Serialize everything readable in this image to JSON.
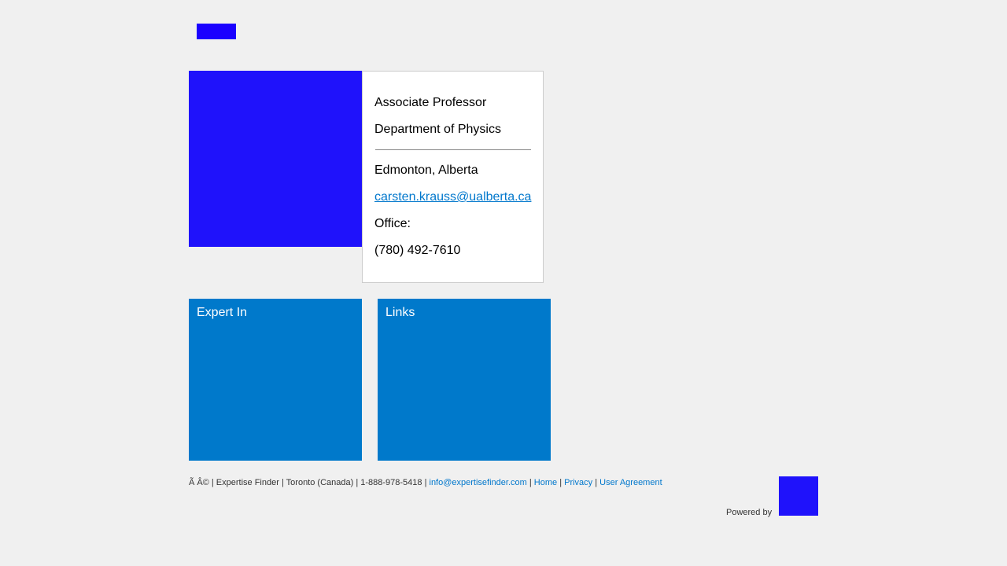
{
  "header": {
    "logo_color": "#1a00ff"
  },
  "profile": {
    "photo_color": "#1f12fb",
    "title": "Associate Professor",
    "department": "Department of Physics",
    "location": "Edmonton, Alberta",
    "email": "carsten.krauss@ualberta.ca",
    "office_label": "Office:",
    "phone": "(780) 492-7610"
  },
  "tiles": [
    {
      "label": "Expert In",
      "color": "#0079cb"
    },
    {
      "label": "Links",
      "color": "#0079cb"
    }
  ],
  "footer": {
    "copyright": "Ã   Â© | Expertise Finder | Toronto (Canada) | 1-888-978-5418 |",
    "email_link": "info@expertisefinder.com",
    "sep": "|",
    "home_link": "Home",
    "privacy_link": "Privacy",
    "agreement_link": "User Agreement",
    "powered_by": "Powered by",
    "powered_logo_color": "#1f12fb",
    "link_color": "#0077cc"
  }
}
